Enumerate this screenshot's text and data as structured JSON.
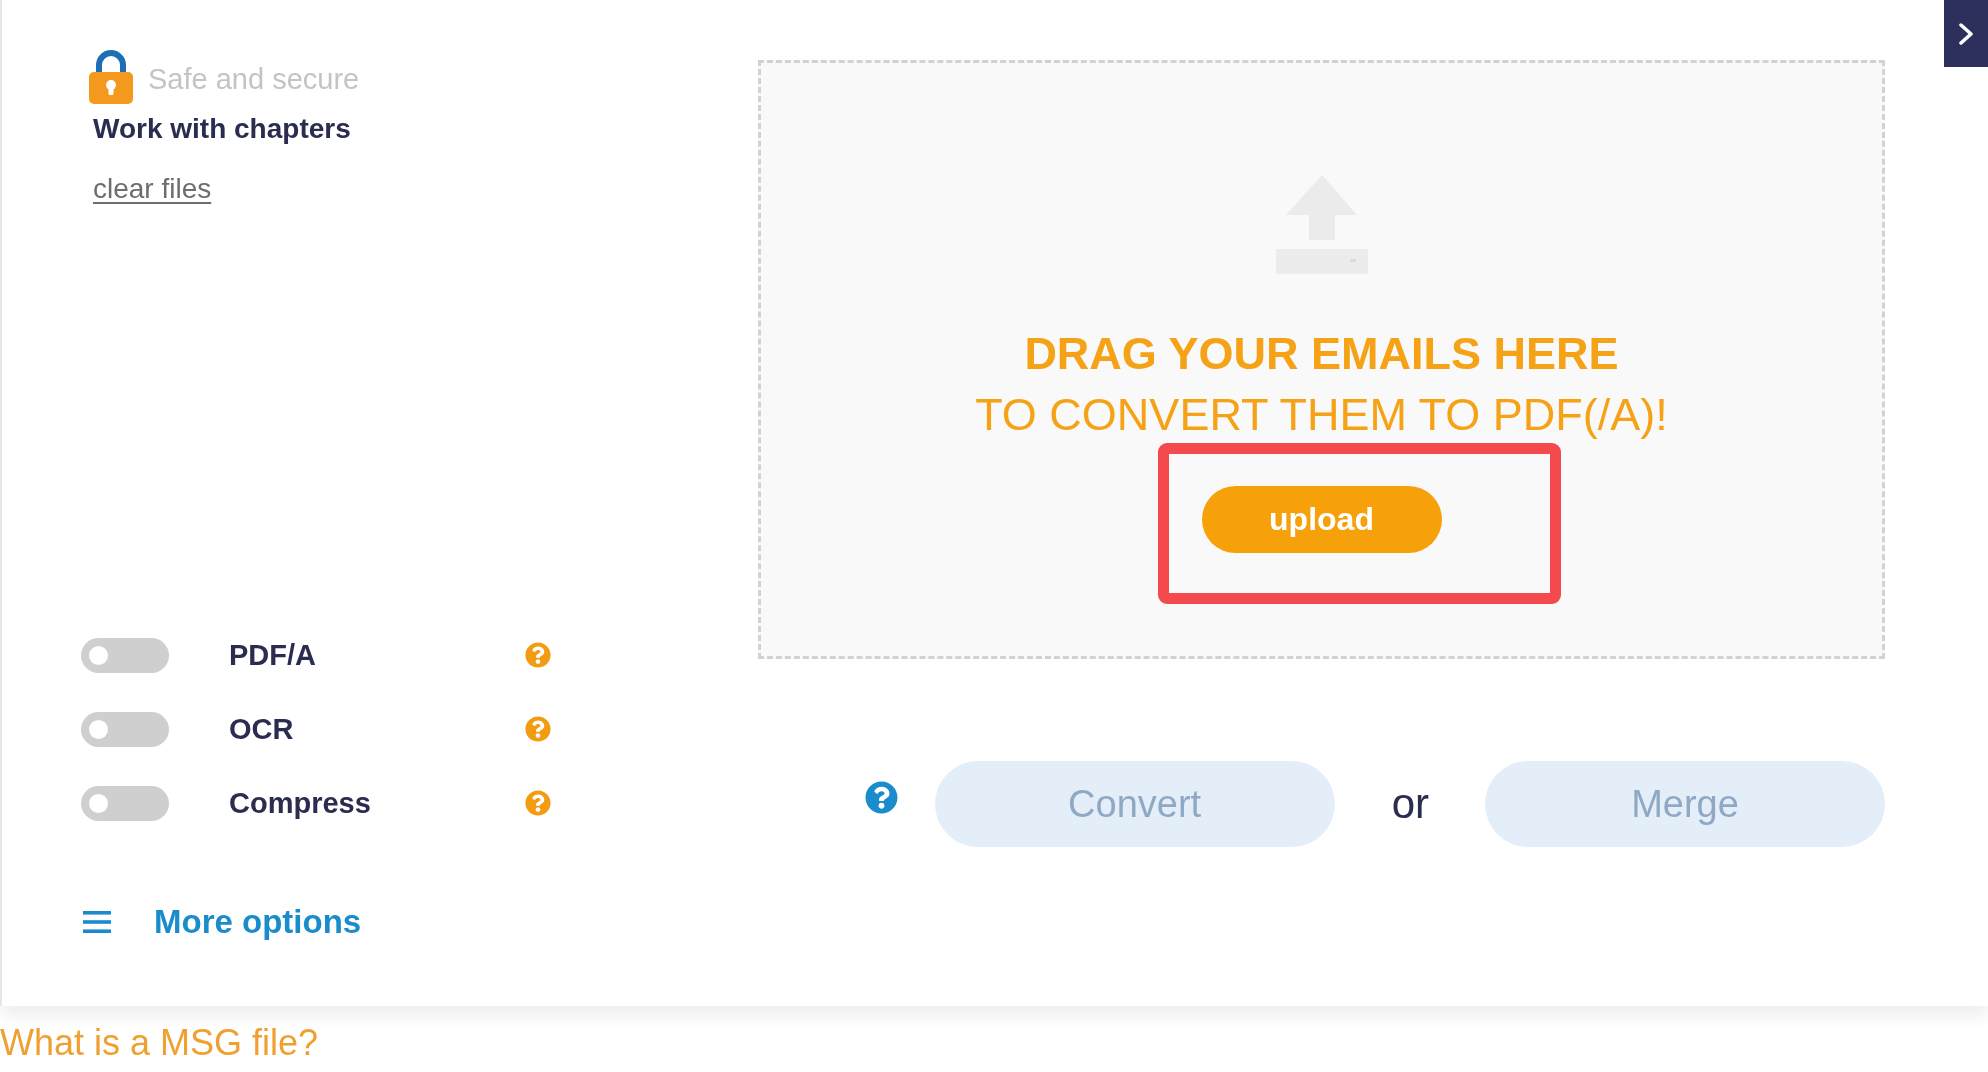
{
  "security": {
    "label": "Safe and secure"
  },
  "feature_title": "Work with chapters",
  "clear_link": "clear files",
  "options": [
    {
      "label": "PDF/A",
      "on": false
    },
    {
      "label": "OCR",
      "on": false
    },
    {
      "label": "Compress",
      "on": false
    }
  ],
  "more_options": "More options",
  "dropzone": {
    "headline": "DRAG YOUR EMAILS HERE",
    "subline": "TO CONVERT THEM TO PDF(/A)!",
    "upload_button": {
      "label": "upload",
      "highlighted": true
    }
  },
  "actions": {
    "convert": {
      "label": "Convert",
      "disabled": true
    },
    "separator": "or",
    "merge": {
      "label": "Merge",
      "disabled": true
    }
  },
  "footer_heading": "What is a MSG file?"
}
